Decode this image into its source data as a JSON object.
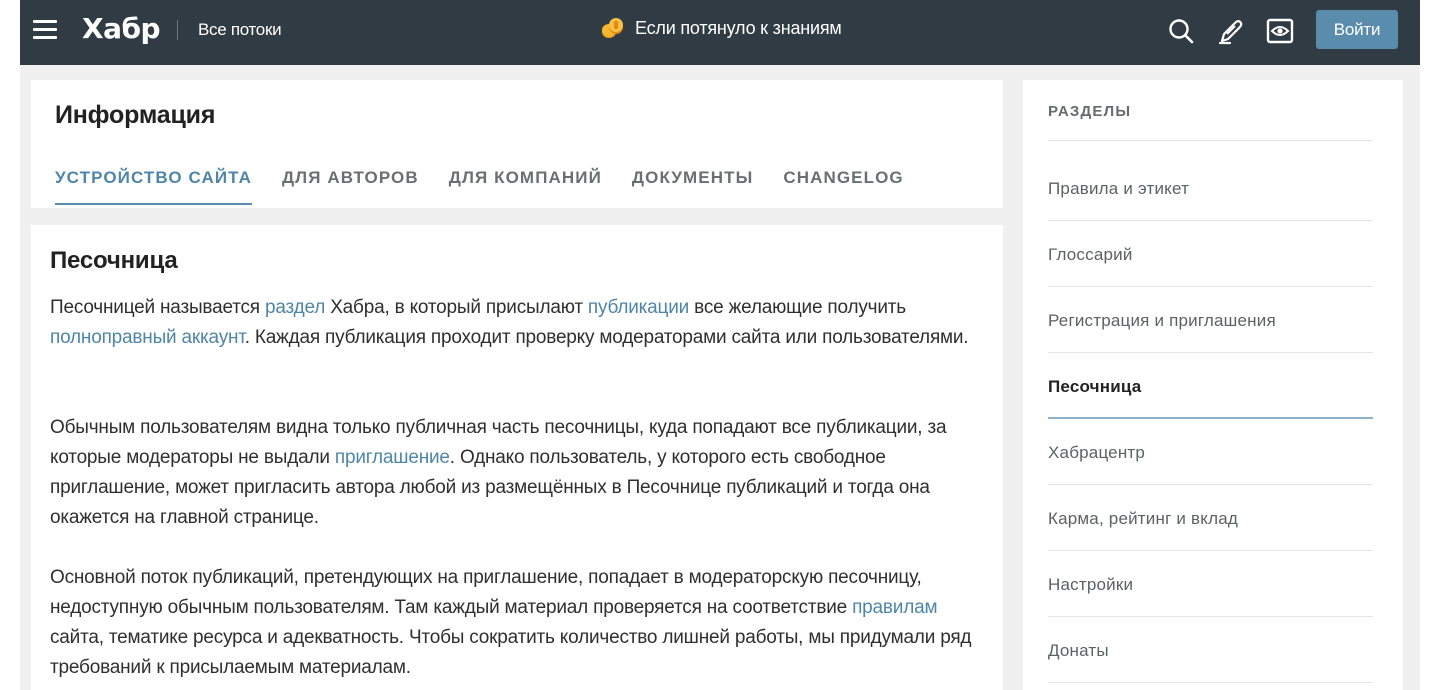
{
  "header": {
    "logo": "Хабр",
    "all_streams": "Все потоки",
    "promo_text": "Если потянуло к знаниям",
    "login_label": "Войти",
    "icons": [
      "menu-icon",
      "coins-icon",
      "search-icon",
      "write-icon",
      "eye-icon"
    ],
    "colors": {
      "bar": "#303b44",
      "login_button": "#5a8cae"
    }
  },
  "info": {
    "title": "Информация",
    "tabs": [
      {
        "label": "УСТРОЙСТВО САЙТА",
        "active": true
      },
      {
        "label": "ДЛЯ АВТОРОВ",
        "active": false
      },
      {
        "label": "ДЛЯ КОМПАНИЙ",
        "active": false
      },
      {
        "label": "ДОКУМЕНТЫ",
        "active": false
      },
      {
        "label": "CHANGELOG",
        "active": false
      }
    ]
  },
  "article": {
    "title": "Песочница",
    "p1": {
      "t1": "Песочницей называется ",
      "link1": "раздел",
      "t2": " Хабра, в который присылают ",
      "link2": "публикации",
      "t3": " все желающие получить ",
      "link3": "полноправный аккаунт",
      "t4": ". Каждая публикация проходит проверку модераторами сайта или пользователями."
    },
    "p2": {
      "t1": "Обычным пользователям видна только публичная часть песочницы, куда попадают все публикации, за которые модераторы не выдали ",
      "link1": "приглашение",
      "t2": ". Однако пользователь, у которого есть свободное приглашение, может пригласить автора любой из размещённых в Песочнице публикаций и тогда она окажется на главной странице."
    },
    "p3": {
      "t1": "Основной поток публикаций, претендующих на приглашение, попадает в модераторскую песочницу, недоступную обычным пользователям. Там каждый материал проверяется на соответствие ",
      "link1": "правилам",
      "t2": " сайта, тематике ресурса и адекватность. Чтобы сократить количество лишней работы, мы придумали ряд требований к присылаемым материалам."
    },
    "link_color": "#4f86a8"
  },
  "sidebar": {
    "heading": "РАЗДЕЛЫ",
    "items": [
      {
        "label": "Правила и этикет",
        "active": false
      },
      {
        "label": "Глоссарий",
        "active": false
      },
      {
        "label": "Регистрация и приглашения",
        "active": false
      },
      {
        "label": "Песочница",
        "active": true
      },
      {
        "label": "Хабрацентр",
        "active": false
      },
      {
        "label": "Карма, рейтинг и вклад",
        "active": false
      },
      {
        "label": "Настройки",
        "active": false
      },
      {
        "label": "Донаты",
        "active": false
      }
    ]
  }
}
